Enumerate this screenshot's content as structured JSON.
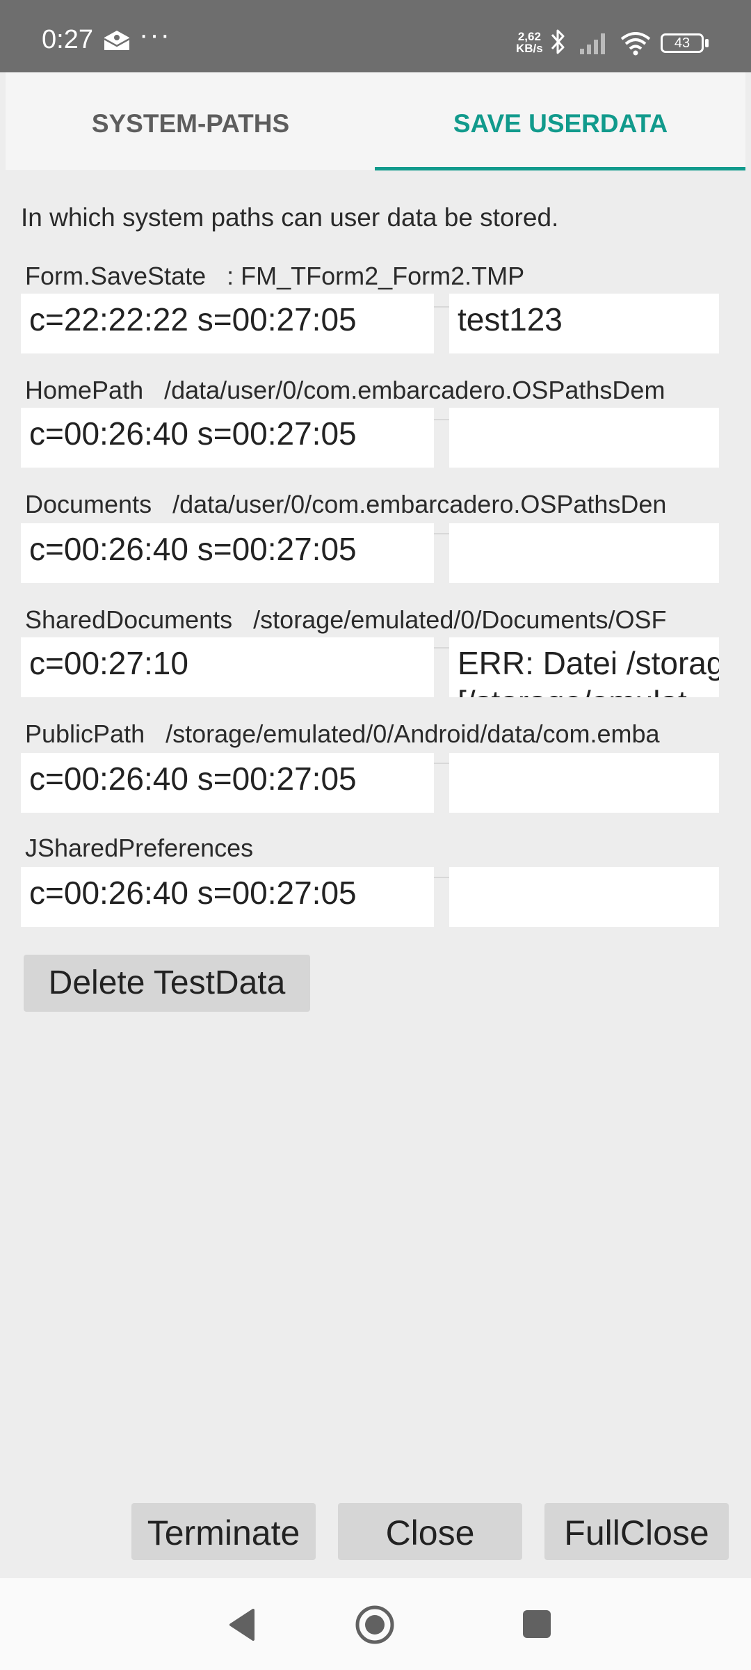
{
  "status_bar": {
    "time": "0:27",
    "dots": "···",
    "speed_value": "2,62",
    "speed_unit": "KB/s",
    "battery": "43"
  },
  "tabs": [
    {
      "label": "SYSTEM-PATHS",
      "active": false
    },
    {
      "label": "SAVE USERDATA",
      "active": true
    }
  ],
  "accent_color": "#119a8c",
  "description": "In which system paths can user data be stored.",
  "rows": [
    {
      "label": "Form.SaveState   : FM_TForm2_Form2.TMP",
      "left_value": "c=22:22:22  s=00:27:05",
      "right_value": "test123"
    },
    {
      "label": "HomePath   /data/user/0/com.embarcadero.OSPathsDem",
      "left_value": "c=00:26:40  s=00:27:05",
      "right_value": ""
    },
    {
      "label": "Documents   /data/user/0/com.embarcadero.OSPathsDen",
      "left_value": "c=00:26:40  s=00:27:05",
      "right_value": ""
    },
    {
      "label": "SharedDocuments   /storage/emulated/0/Documents/OSF",
      "left_value": "c=00:27:10",
      "right_value": "ERR: Datei /storag",
      "right_value_line2": "[/storage/emulat"
    },
    {
      "label": "PublicPath   /storage/emulated/0/Android/data/com.emba",
      "left_value": "c=00:26:40  s=00:27:05",
      "right_value": ""
    },
    {
      "label": "JSharedPreferences",
      "left_value": "c=00:26:40  s=00:27:05",
      "right_value": ""
    }
  ],
  "buttons": {
    "delete": "Delete TestData",
    "terminate": "Terminate",
    "close": "Close",
    "fullclose": "FullClose"
  }
}
